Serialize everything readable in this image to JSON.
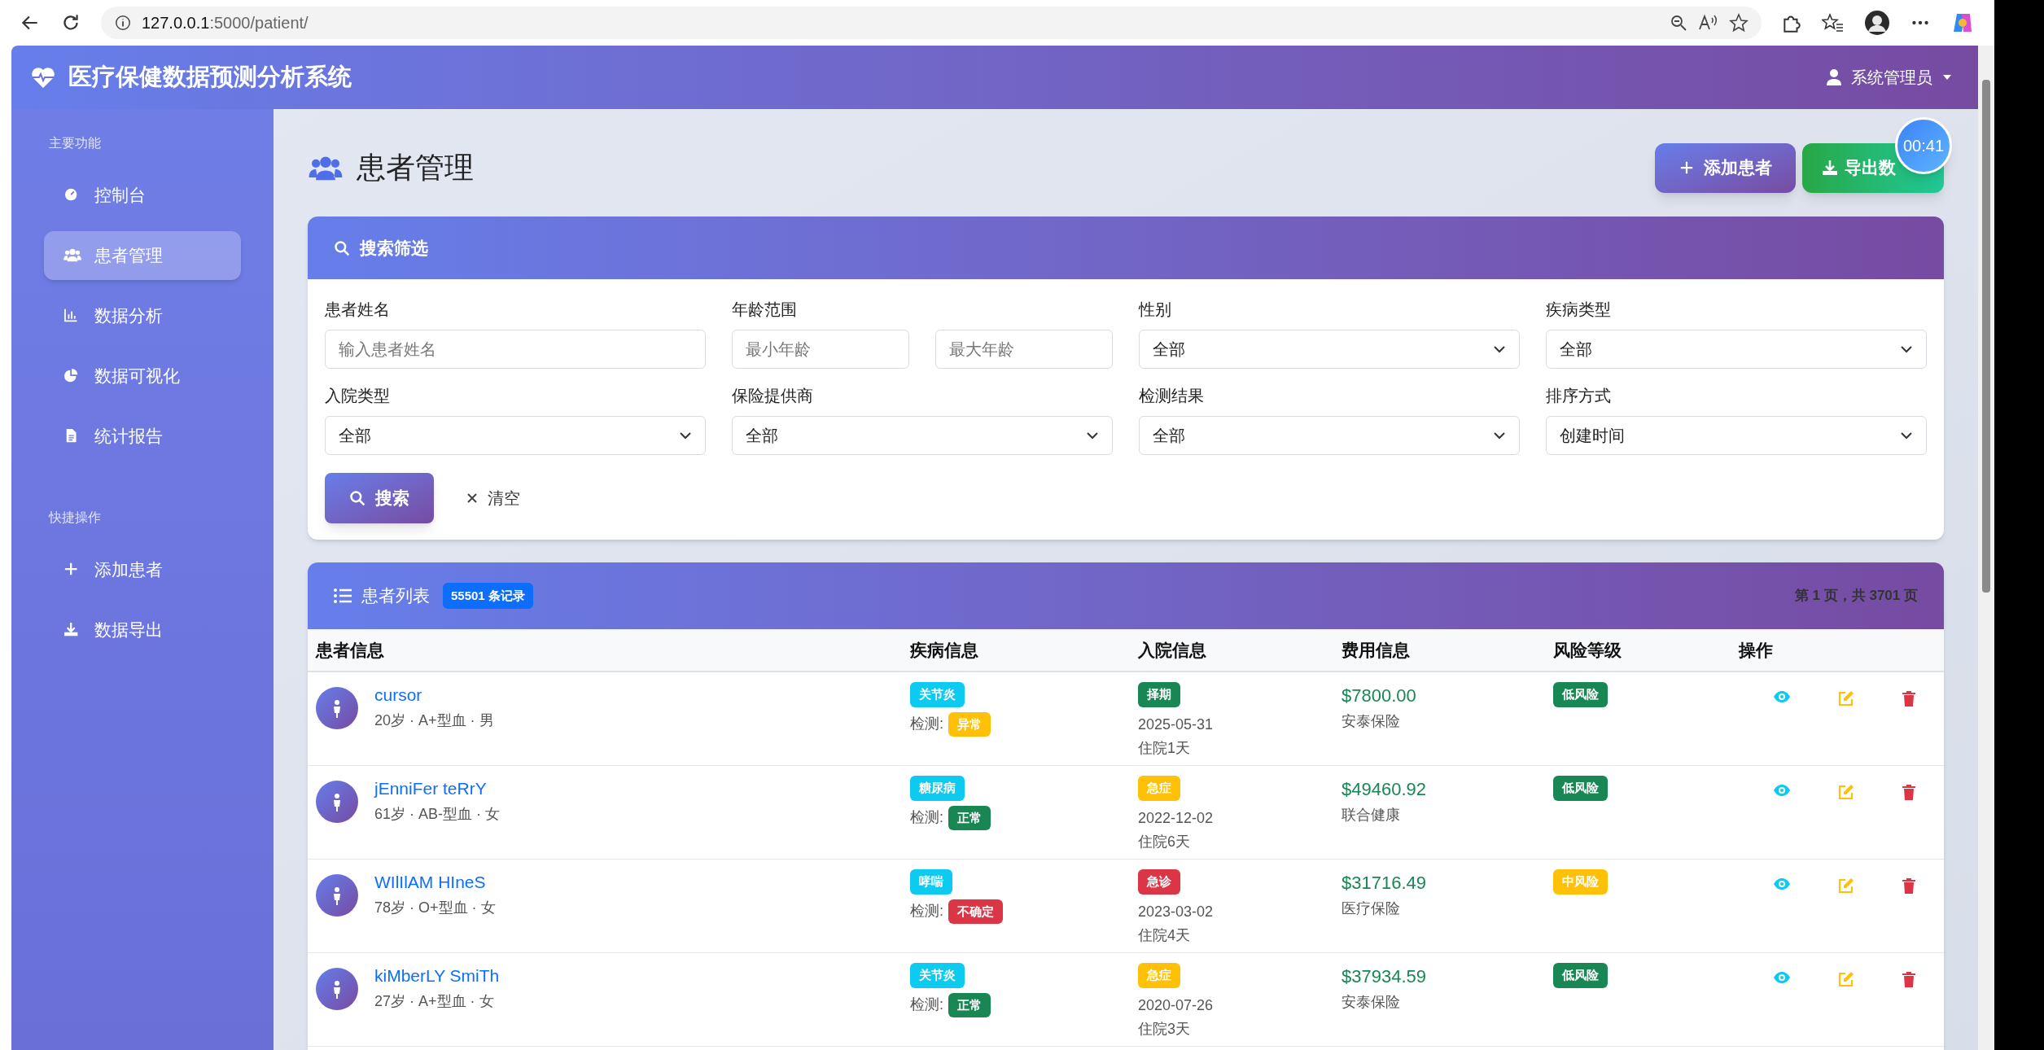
{
  "browser": {
    "url_host": "127.0.0.1",
    "url_path": ":5000/patient/"
  },
  "app": {
    "title": "医疗保健数据预测分析系统",
    "user": "系统管理员"
  },
  "sidebar": {
    "sections": [
      {
        "title": "主要功能",
        "items": [
          {
            "label": "控制台",
            "kind": "gauge",
            "selected": false
          },
          {
            "label": "患者管理",
            "kind": "users",
            "selected": true
          },
          {
            "label": "数据分析",
            "kind": "chart",
            "selected": false
          },
          {
            "label": "数据可视化",
            "kind": "pie",
            "selected": false
          },
          {
            "label": "统计报告",
            "kind": "file",
            "selected": false
          }
        ]
      },
      {
        "title": "快捷操作",
        "items": [
          {
            "label": "添加患者",
            "kind": "plus",
            "selected": false
          },
          {
            "label": "数据导出",
            "kind": "download",
            "selected": false
          }
        ]
      }
    ]
  },
  "page": {
    "title": "患者管理",
    "add_button": "添加患者",
    "export_button": "导出数",
    "timer": "00:41"
  },
  "filters": {
    "title": "搜索筛选",
    "fields": [
      {
        "kind": "text",
        "label": "患者姓名",
        "placeholder": "输入患者姓名"
      },
      {
        "kind": "range",
        "label": "年龄范围",
        "placeholder": "最小年龄",
        "placeholder_2": "最大年龄"
      },
      {
        "kind": "select",
        "label": "性别",
        "value": "全部"
      },
      {
        "kind": "select",
        "label": "疾病类型",
        "value": "全部"
      },
      {
        "kind": "select",
        "label": "入院类型",
        "value": "全部"
      },
      {
        "kind": "select",
        "label": "保险提供商",
        "value": "全部"
      },
      {
        "kind": "select",
        "label": "检测结果",
        "value": "全部"
      },
      {
        "kind": "select",
        "label": "排序方式",
        "value": "创建时间"
      }
    ],
    "search_button": "搜索",
    "clear_button": "清空"
  },
  "list": {
    "title": "患者列表",
    "count": "55501 条记录",
    "pagination": "第 1 页，共 3701 页",
    "columns": [
      "患者信息",
      "疾病信息",
      "入院信息",
      "费用信息",
      "风险等级",
      "操作"
    ],
    "rows": [
      {
        "name": "cursor",
        "meta": "20岁 · A+型血 · 男",
        "disease": "关节炎",
        "test_label": "检测:",
        "test": {
          "text": "异常",
          "color": "#ffc107"
        },
        "admission": {
          "text": "择期",
          "color": "#198754"
        },
        "date": "2025-05-31",
        "stay": "住院1天",
        "cost": "$7800.00",
        "insurer": "安泰保险",
        "risk": {
          "text": "低风险",
          "color": "#198754"
        }
      },
      {
        "name": "jEnniFer teRrY",
        "meta": "61岁 · AB-型血 · 女",
        "disease": "糖尿病",
        "test_label": "检测:",
        "test": {
          "text": "正常",
          "color": "#198754"
        },
        "admission": {
          "text": "急症",
          "color": "#ffc107"
        },
        "date": "2022-12-02",
        "stay": "住院6天",
        "cost": "$49460.92",
        "insurer": "联合健康",
        "risk": {
          "text": "低风险",
          "color": "#198754"
        }
      },
      {
        "name": "WIlIlAM HIneS",
        "meta": "78岁 · O+型血 · 女",
        "disease": "哮喘",
        "test_label": "检测:",
        "test": {
          "text": "不确定",
          "color": "#dc3545"
        },
        "admission": {
          "text": "急诊",
          "color": "#dc3545"
        },
        "date": "2023-03-02",
        "stay": "住院4天",
        "cost": "$31716.49",
        "insurer": "医疗保险",
        "risk": {
          "text": "中风险",
          "color": "#ffc107"
        }
      },
      {
        "name": "kiMberLY SmiTh",
        "meta": "27岁 · A+型血 · 女",
        "disease": "关节炎",
        "test_label": "检测:",
        "test": {
          "text": "正常",
          "color": "#198754"
        },
        "admission": {
          "text": "急症",
          "color": "#ffc107"
        },
        "date": "2020-07-26",
        "stay": "住院3天",
        "cost": "$37934.59",
        "insurer": "安泰保险",
        "risk": {
          "text": "低风险",
          "color": "#198754"
        }
      }
    ]
  }
}
